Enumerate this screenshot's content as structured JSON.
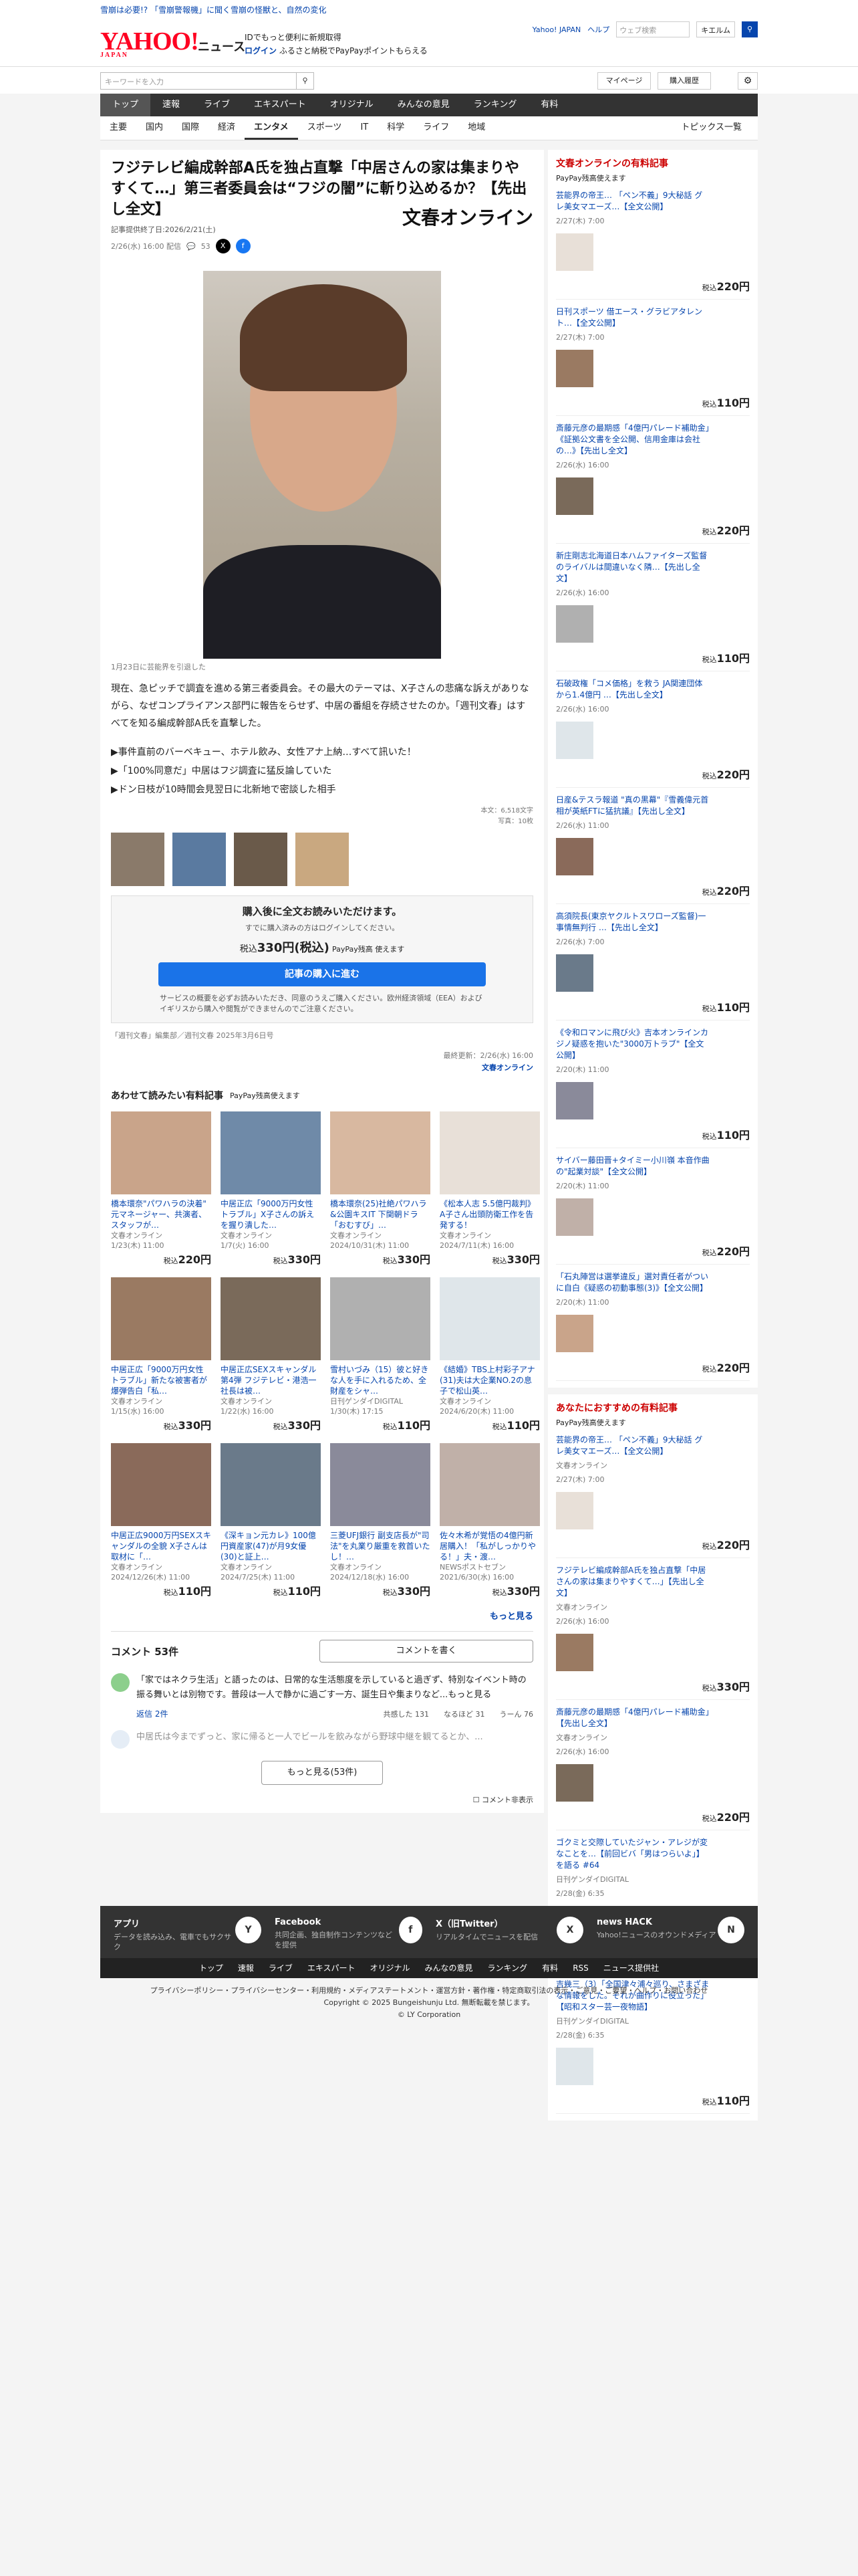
{
  "topnotice": "雪崩は必要!? 「雪崩警報機」に聞く雪崩の怪獣と、自然の変化",
  "logo": "YAHOO!",
  "logo_sub": "JAPAN",
  "logo_news": "ニュース",
  "promo": {
    "line1": "IDでもっと便利に新規取得",
    "line2": "ログイン",
    "line3": "ふるさと納税でPayPayポイントもらえる"
  },
  "header_right": {
    "yj": "Yahoo! JAPAN",
    "help": "ヘルプ",
    "search_ph": "ウェブ検索",
    "kw": "キエルム"
  },
  "search": {
    "placeholder": "キーワードを入力",
    "mypage": "マイページ",
    "history": "購入履歴"
  },
  "mainnav": [
    "トップ",
    "速報",
    "ライブ",
    "エキスパート",
    "オリジナル",
    "みんなの意見",
    "ランキング",
    "有料"
  ],
  "subnav": [
    "主要",
    "国内",
    "国際",
    "経済",
    "エンタメ",
    "スポーツ",
    "IT",
    "科学",
    "ライフ",
    "地域"
  ],
  "subnav_topics": "トピックス一覧",
  "article": {
    "title": "フジテレビ編成幹部A氏を独占直撃「中居さんの家は集まりやすくて…」第三者委員会は“フジの闇”に斬り込めるか？【先出し全文】",
    "provider": "記事提供終了日:2026/2/21(土)",
    "date": "2/26(水) 16:00 配信",
    "comments_count": "53",
    "publisher": "文春オンライン",
    "caption": "1月23日に芸能界を引退した",
    "body": "現在、急ピッチで調査を進める第三者委員会。その最大のテーマは、X子さんの悲痛な訴えがありながら、なぜコンプライアンス部門に報告をらせず、中居の番組を存続させたのか。「週刊文春」はすべてを知る編成幹部A氏を直撃した。",
    "links": [
      "▶事件直前のバーベキュー、ホテル飲み、女性アナ上納…すべて訊いた！",
      "▶「100%同意だ」中居はフジ調査に猛反論していた",
      "▶ドン日枝が10時間会見翌日に北新地で密談した相手"
    ],
    "counts": [
      "本文：6,518文字",
      "写真：10枚"
    ],
    "paywall": {
      "title": "購入後に全文お読みいただけます。",
      "sub": "すでに購入済みの方はログインしてください。",
      "price_pre": "税込",
      "price": "330円(税込)",
      "pp": "PayPay残高 使えます",
      "buy": "記事の購入に進む",
      "note": "サービスの概要を必ずお読みいただき、同意のうえご購入ください。欧州経済領域（EEA）およびイギリスから購入や閲覧ができませんのでご注意ください。"
    },
    "credits": "「週刊文春」編集部／週刊文春 2025年3月6日号",
    "updated": "最終更新：2/26(水) 16:00",
    "updated_src": "文春オンライン"
  },
  "related": {
    "title": "あわせて読みたい有料記事",
    "pp": "PayPay残高使えます",
    "items": [
      {
        "title": "橋本環奈\"パワハラの決着\" 元マネージャー、共演者、スタッフが…",
        "src": "文春オンライン",
        "date": "1/23(木) 11:00",
        "price": "220円"
      },
      {
        "title": "中居正広「9000万円女性トラブル」X子さんの訴えを握り潰した…",
        "src": "文春オンライン",
        "date": "1/7(火) 16:00",
        "price": "330円"
      },
      {
        "title": "橋本環奈(25)社絶パワハラ&公園キスIT 下関朝ドラ「おむすび」…",
        "src": "文春オンライン",
        "date": "2024/10/31(木) 11:00",
        "price": "330円"
      },
      {
        "title": "《松本人志 5.5億円裁判》A子さん出頭防衛工作を告発する！",
        "src": "文春オンライン",
        "date": "2024/7/11(木) 16:00",
        "price": "330円"
      },
      {
        "title": "中居正広「9000万円女性トラブル」新たな被害者が爆弾告白「私…",
        "src": "文春オンライン",
        "date": "1/15(水) 16:00",
        "price": "330円"
      },
      {
        "title": "中居正広SEXスキャンダル第4弾 フジテレビ・港浩一社長は被…",
        "src": "文春オンライン",
        "date": "1/22(水) 16:00",
        "price": "330円"
      },
      {
        "title": "雪村いづみ（15）彼と好きな人を手に入れるため、全財産をシャ…",
        "src": "日刊ゲンダイDIGITAL",
        "date": "1/30(木) 17:15",
        "price": "110円"
      },
      {
        "title": "《結婚》TBS上村彩子アナ(31)夫は大企業NO.2の息子で松山英…",
        "src": "文春オンライン",
        "date": "2024/6/20(木) 11:00",
        "price": "110円"
      },
      {
        "title": "中居正広9000万円SEXスキャンダルの全貌 X子さんは取材に「…",
        "src": "文春オンライン",
        "date": "2024/12/26(木) 11:00",
        "price": "110円"
      },
      {
        "title": "《深キョン元カレ》100億円資産家(47)が月9女優(30)と証上…",
        "src": "文春オンライン",
        "date": "2024/7/25(木) 11:00",
        "price": "110円"
      },
      {
        "title": "三菱UFJ銀行 副支店長が\"司法\"を丸業り厳重を救首いたし！…",
        "src": "文春オンライン",
        "date": "2024/12/18(水) 16:00",
        "price": "330円"
      },
      {
        "title": "佐々木希が覚悟の4億円新居購入！「私がしっかりやる！」夫・渡…",
        "src": "NEWSポストセブン",
        "date": "2021/6/30(水) 16:00",
        "price": "330円"
      }
    ],
    "more": "もっと見る"
  },
  "comments": {
    "title": "コメント 53件",
    "write": "コメントを書く",
    "first": "「家ではネクラ生活」と語ったのは、日常的な生活態度を示していると過ぎず、特別なイベント時の振る舞いとは別物です。普段は一人で静かに過ごす一方、誕生日や集まりなど...もっと見る",
    "reply": "返信 2件",
    "reactions": [
      {
        "label": "共感した",
        "n": "131"
      },
      {
        "label": "なるほど",
        "n": "31"
      },
      {
        "label": "うーん",
        "n": "76"
      }
    ],
    "second": "中居氏は今までずっと、家に帰ると一人でビールを飲みながら野球中継を観てるとか、...",
    "more": "もっと見る(53件)",
    "hide": "コメント非表示"
  },
  "side": {
    "title": "文春オンラインの有料記事",
    "pp": "PayPay残高使えます",
    "items": [
      {
        "title": "芸能界の帝王… 「ペン不義」9大秘話 グレ美女マエーズ…【全文公開】",
        "date": "2/27(木) 7:00",
        "price": "220円"
      },
      {
        "title": "日刊スポーツ 借エース・グラビアタレント…【全文公開】",
        "date": "2/27(木) 7:00",
        "price": "110円"
      },
      {
        "title": "斎藤元彦の最期感「4億円パレード補助金」《証拠公文書を全公開、信用金庫は会社の…》【先出し全文】",
        "date": "2/26(水) 16:00",
        "price": "220円"
      },
      {
        "title": "新庄剛志北海道日本ハムファイターズ監督のライバルは間違いなく隣…【先出し全文】",
        "date": "2/26(水) 16:00",
        "price": "110円"
      },
      {
        "title": "石破政権「コメ価格」を救う JA関連団体から1.4億円 …【先出し全文】",
        "date": "2/26(水) 16:00",
        "price": "220円"
      },
      {
        "title": "日産&テスラ報道 \"真の黒幕\"『雪義偉元首相が英紙FTに猛抗議』【先出し全文】",
        "date": "2/26(水) 11:00",
        "price": "220円"
      },
      {
        "title": "高須院長(東京ヤクルトスワローズ監督)一事情無判行 …【先出し全文】",
        "date": "2/26(水) 7:00",
        "price": "110円"
      },
      {
        "title": "《令和ロマンに飛び火》吉本オンラインカジノ疑惑を抱いた\"3000万トラブ\"【全文公開】",
        "date": "2/20(木) 11:00",
        "price": "110円"
      },
      {
        "title": "サイバー藤田晋+タイミー小川嶺 本音作曲の\"起業対談\"【全文公開】",
        "date": "2/20(木) 11:00",
        "price": "220円"
      },
      {
        "title": "「石丸陣営は選挙違反」選対責任者がついに自白《疑惑の初動事態(3)》【全文公開】",
        "date": "2/20(木) 11:00",
        "price": "220円"
      }
    ],
    "title2": "あなたにおすすめの有料記事",
    "items2": [
      {
        "title": "芸能界の帝王… 「ペン不義」9大秘話 グレ美女マエーズ…【全文公開】",
        "src": "文春オンライン",
        "date": "2/27(木) 7:00",
        "price": "220円"
      },
      {
        "title": "フジテレビ編成幹部A氏を独占直撃「中居さんの家は集まりやすくて…」【先出し全文】",
        "src": "文春オンライン",
        "date": "2/26(水) 16:00",
        "price": "330円"
      },
      {
        "title": "斎藤元彦の最期感「4億円パレード補助金」【先出し全文】",
        "src": "文春オンライン",
        "date": "2/26(水) 16:00",
        "price": "220円"
      },
      {
        "title": "ゴクミと交際していたジャン・アレジが変なことを…【前回ビバ「男はつらいよ」】を語る #64",
        "src": "日刊ゲンダイDIGITAL",
        "date": "2/28(金) 6:35",
        "price": "110円"
      },
      {
        "title": "吉幾三（3）「全国津々浦々巡り、さまざまな情報をした。それが曲作りに役立った」【昭和スター芸一夜物語】",
        "src": "日刊ゲンダイDIGITAL",
        "date": "2/28(金) 6:35",
        "price": "110円"
      }
    ]
  },
  "footer": {
    "cols": [
      {
        "t": "アプリ",
        "d": "データを読み込み、電車でもサクサク",
        "ic": "Y"
      },
      {
        "t": "Facebook",
        "d": "共同企画、独自制作コンテンツなどを提供",
        "ic": "f"
      },
      {
        "t": "X（旧Twitter）",
        "d": "リアルタイムでニュースを配信",
        "ic": "X"
      },
      {
        "t": "news HACK",
        "d": "Yahoo!ニュースのオウンドメディア",
        "ic": "N"
      }
    ],
    "links": [
      "トップ",
      "速報",
      "ライブ",
      "エキスパート",
      "オリジナル",
      "みんなの意見",
      "ランキング",
      "有料",
      "RSS",
      "ニュース提供社"
    ],
    "legal1": "プライバシーポリシー・プライバシーセンター・利用規約・メディアステートメント・運営方針・著作権・特定商取引法の表示・ご意見・ご要望・ヘルプ・お問い合わせ",
    "legal2": "Copyright © 2025 Bungeishunju Ltd. 無断転載を禁じます。",
    "legal3": "© LY Corporation"
  }
}
